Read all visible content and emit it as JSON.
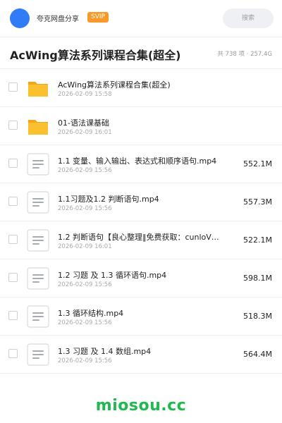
{
  "header": {
    "share_name": "夸克网盘分享",
    "vip_label": "SVIP",
    "search_placeholder": "搜索"
  },
  "folder": {
    "title": "AcWing算法系列课程合集(超全)",
    "summary": "共 738 项 · 257.4G"
  },
  "files": [
    {
      "type": "folder",
      "icon": "folder-icon",
      "name": "AcWing算法系列课程合集(超全)",
      "date": "2026-02-09 15:58",
      "size": ""
    },
    {
      "type": "folder",
      "icon": "folder-icon",
      "name": "01-语法课基础",
      "date": "2026-02-09 16:01",
      "size": ""
    },
    {
      "type": "file",
      "icon": "document-icon",
      "name": "1.1 变量、输入输出、表达式和顺序语句.mp4",
      "date": "2026-02-09 15:56",
      "size": "552.1M"
    },
    {
      "type": "file",
      "icon": "document-icon",
      "name": "1.1习题及1.2 判断语句.mp4",
      "date": "2026-02-09 15:56",
      "size": "557.3M"
    },
    {
      "type": "file",
      "icon": "document-icon",
      "name": "1.2 判断语句【良心整理‖免费获取：cunloV…",
      "date": "2026-02-09 16:01",
      "size": "522.1M"
    },
    {
      "type": "file",
      "icon": "document-icon",
      "name": "1.2 习题 及 1.3 循环语句.mp4",
      "date": "2026-02-09 15:56",
      "size": "598.1M"
    },
    {
      "type": "file",
      "icon": "document-icon",
      "name": "1.3 循环结构.mp4",
      "date": "2026-02-09 15:56",
      "size": "518.3M"
    },
    {
      "type": "file",
      "icon": "document-icon",
      "name": "1.3 习题 及 1.4 数组.mp4",
      "date": "2026-02-09 15:56",
      "size": "564.4M"
    }
  ],
  "watermark": "miosou.cc",
  "colors": {
    "avatar": "#2f7cf6",
    "vip_badge": "#f79a2a",
    "folder": "#fbc02d",
    "watermark": "#20b84f"
  }
}
